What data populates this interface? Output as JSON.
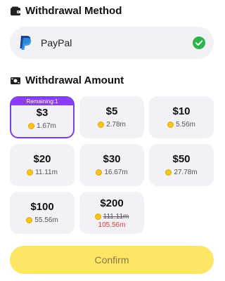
{
  "method_section": {
    "title": "Withdrawal Method",
    "icon": "wallet-icon"
  },
  "method": {
    "label": "PayPal",
    "icon": "paypal-icon",
    "selected": true
  },
  "amount_section": {
    "title": "Withdrawal Amount",
    "icon": "cash-icon"
  },
  "amounts": [
    {
      "price": "$3",
      "coins": "1.67m",
      "badge": "Remaining:1",
      "selected": true
    },
    {
      "price": "$5",
      "coins": "2.78m"
    },
    {
      "price": "$10",
      "coins": "5.56m"
    },
    {
      "price": "$20",
      "coins": "11.11m"
    },
    {
      "price": "$30",
      "coins": "16.67m"
    },
    {
      "price": "$50",
      "coins": "27.78m"
    },
    {
      "price": "$100",
      "coins": "55.56m"
    },
    {
      "price": "$200",
      "old_coins": "111.11m",
      "new_coins": "105.56m"
    }
  ],
  "confirm_label": "Confirm",
  "colors": {
    "accent": "#8b3cf5",
    "confirm_bg": "#fde566",
    "check": "#2db34a",
    "discount": "#e03a3a"
  }
}
